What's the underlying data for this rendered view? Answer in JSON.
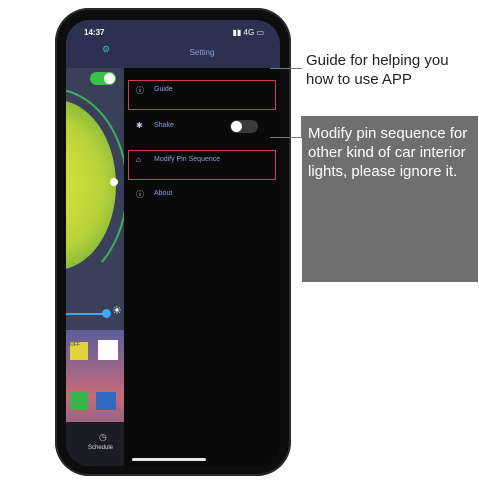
{
  "status": {
    "time": "14:37",
    "signal": "4G"
  },
  "settings": {
    "title": "Setting",
    "items": [
      {
        "label": "Guide",
        "icon": "help-circle-icon"
      },
      {
        "label": "Shake",
        "icon": "shake-icon"
      },
      {
        "label": "Modify Pin Sequence",
        "icon": "pin-icon"
      },
      {
        "label": "About",
        "icon": "info-icon"
      }
    ]
  },
  "left_panel": {
    "tab_label": "Schedule",
    "swatch_label": "OFF"
  },
  "callouts": [
    {
      "text": "Guide for helping you how to use APP"
    },
    {
      "text": "Modify pin sequence for other kind of car interior lights, please ignore it."
    }
  ],
  "colors": {
    "highlight": "#d23a5a",
    "panel_text": "#8fa0d8",
    "callout_bg": "#6f6f6f"
  }
}
